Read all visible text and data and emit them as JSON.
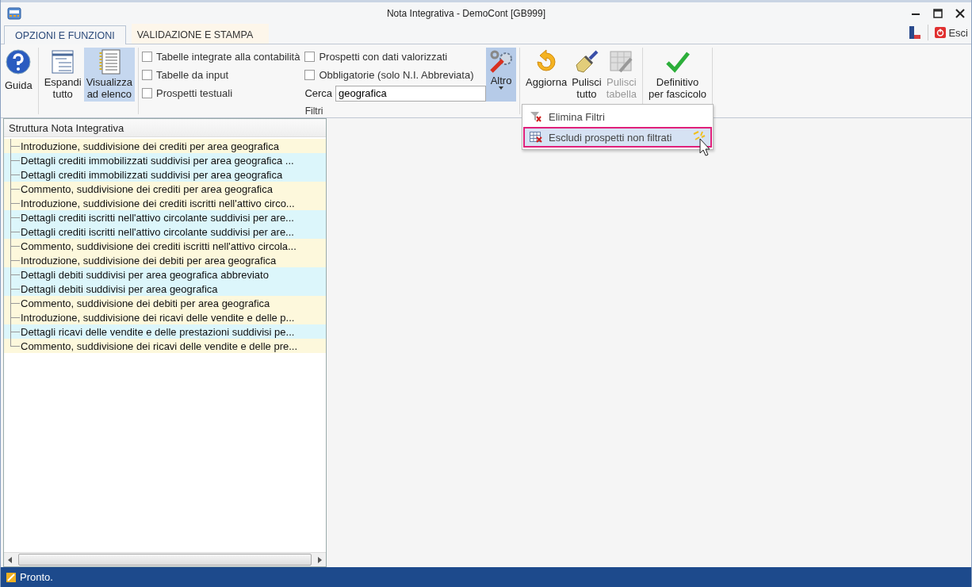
{
  "window": {
    "title": "Nota Integrativa - DemoCont [GB999]"
  },
  "tabs": [
    {
      "label": "OPZIONI E FUNZIONI",
      "selected": true
    },
    {
      "label": "VALIDAZIONE E STAMPA",
      "selected": false
    }
  ],
  "exit_button": {
    "label": "Esci"
  },
  "ribbon": {
    "help_button": {
      "label": "Guida"
    },
    "view_buttons": [
      {
        "label": "Espandi\ntutto",
        "on": false
      },
      {
        "label": "Visualizza\nad elenco",
        "on": true
      }
    ],
    "filters": {
      "title": "Filtri",
      "checkboxes": [
        {
          "label": "Tabelle integrate alla contabilità",
          "checked": false
        },
        {
          "label": "Tabelle da input",
          "checked": false
        },
        {
          "label": "Prospetti testuali",
          "checked": false
        },
        {
          "label": "Prospetti con dati valorizzati",
          "checked": false
        },
        {
          "label": "Obbligatorie (solo N.I. Abbreviata)",
          "checked": false
        }
      ],
      "search": {
        "label": "Cerca",
        "value": "geografica"
      }
    },
    "more_button": {
      "label": "Altro",
      "expanded": true
    },
    "action_buttons": [
      {
        "label": "Aggiorna\n ",
        "disabled": false
      },
      {
        "label": "Pulisci\ntutto",
        "disabled": false
      },
      {
        "label": "Pulisci\ntabella",
        "disabled": true
      }
    ],
    "final_button": {
      "label": "Definitivo\nper fascicolo"
    }
  },
  "dropdown_menu": {
    "items": [
      {
        "label": "Elimina Filtri",
        "highlighted": false
      },
      {
        "label": "Escludi prospetti non filtrati",
        "highlighted": true
      }
    ]
  },
  "tree": {
    "header": "Struttura Nota Integrativa",
    "items": [
      {
        "label": "Introduzione, suddivisione dei crediti per area geografica",
        "color": "#fdf8dc"
      },
      {
        "label": "Dettagli crediti immobilizzati suddivisi per area geografica ...",
        "color": "#dcf6fb"
      },
      {
        "label": "Dettagli crediti immobilizzati suddivisi per area geografica",
        "color": "#dcf6fb"
      },
      {
        "label": "Commento, suddivisione dei crediti per area geografica",
        "color": "#fdf8dc"
      },
      {
        "label": "Introduzione, suddivisione dei crediti iscritti nell'attivo circo...",
        "color": "#fdf8dc"
      },
      {
        "label": "Dettagli crediti iscritti nell'attivo circolante suddivisi per are...",
        "color": "#dcf6fb"
      },
      {
        "label": "Dettagli crediti iscritti nell'attivo circolante suddivisi per are...",
        "color": "#dcf6fb"
      },
      {
        "label": "Commento, suddivisione dei crediti iscritti nell'attivo circola...",
        "color": "#fdf8dc"
      },
      {
        "label": "Introduzione, suddivisione dei debiti per area geografica",
        "color": "#fdf8dc"
      },
      {
        "label": "Dettagli debiti suddivisi per area geografica abbreviato",
        "color": "#dcf6fb"
      },
      {
        "label": "Dettagli debiti suddivisi per area geografica",
        "color": "#dcf6fb"
      },
      {
        "label": "Commento, suddivisione dei debiti per area geografica",
        "color": "#fdf8dc"
      },
      {
        "label": "Introduzione, suddivisione dei ricavi delle vendite e delle p...",
        "color": "#fdf8dc"
      },
      {
        "label": "Dettagli ricavi delle vendite e delle prestazioni suddivisi pe...",
        "color": "#dcf6fb"
      },
      {
        "label": "Commento, suddivisione dei ricavi delle vendite e delle pre...",
        "color": "#fdf8dc"
      }
    ]
  },
  "status_bar": {
    "text": "Pronto."
  }
}
